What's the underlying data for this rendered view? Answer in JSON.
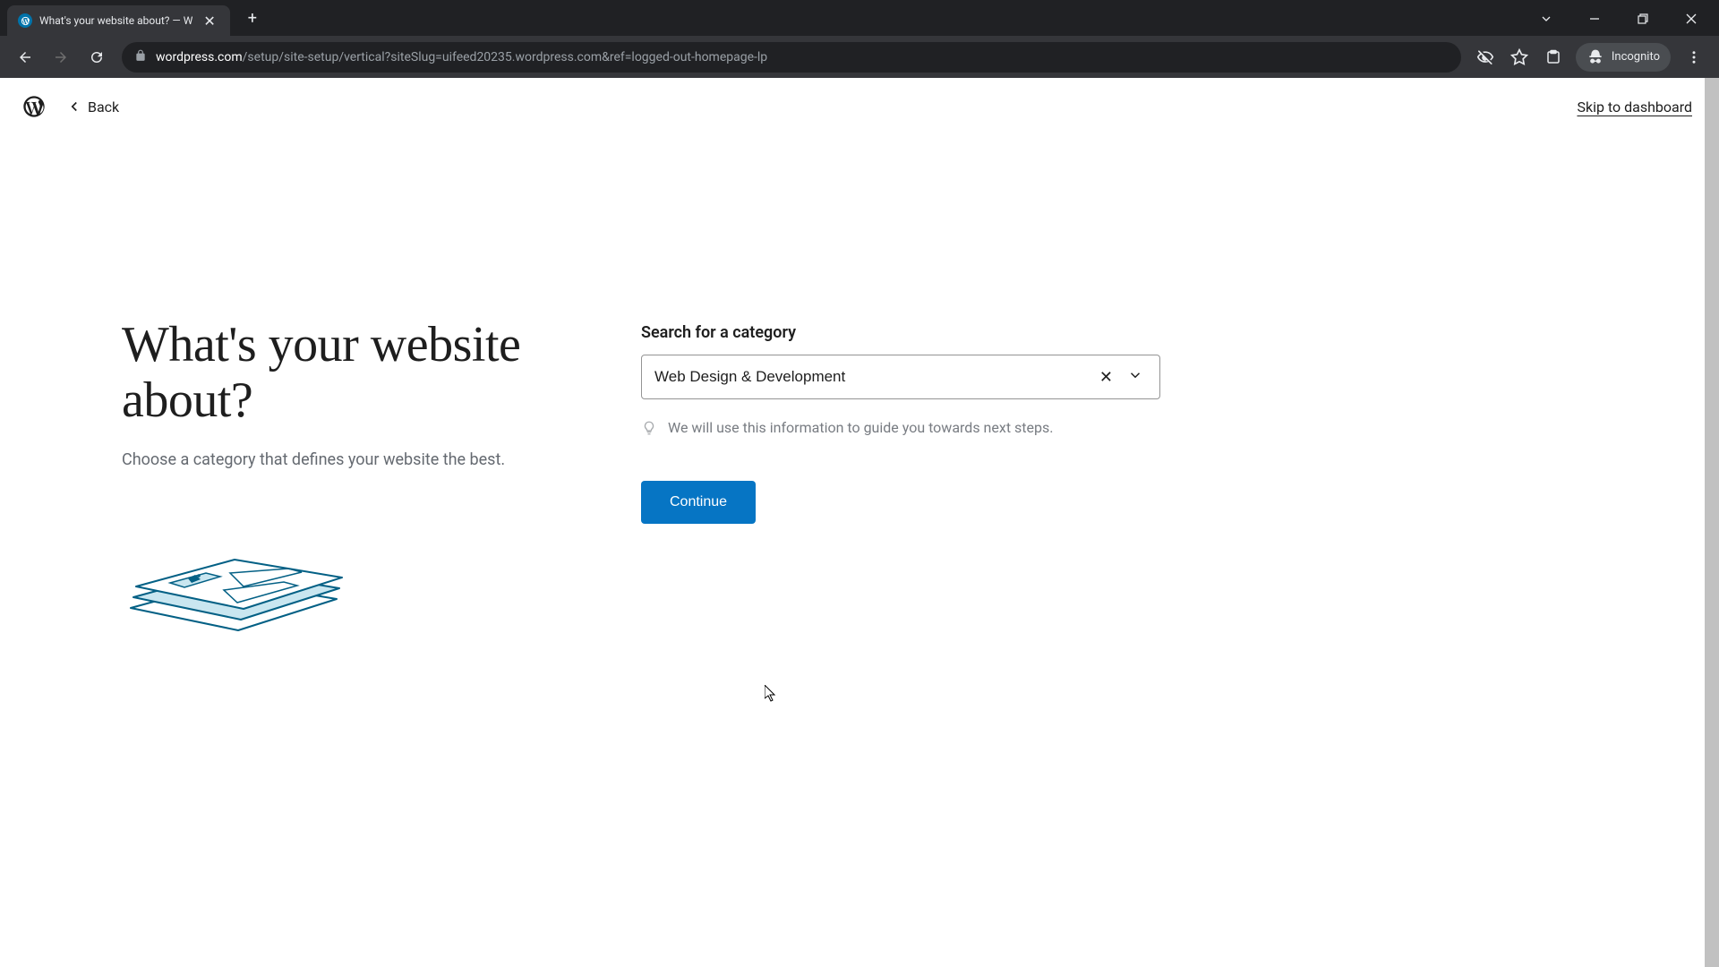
{
  "browser": {
    "tab_title": "What's your website about? — W",
    "url_domain": "wordpress.com",
    "url_path": "/setup/site-setup/vertical?siteSlug=uifeed20235.wordpress.com&ref=logged-out-homepage-lp",
    "incognito_label": "Incognito"
  },
  "header": {
    "back_label": "Back",
    "skip_label": "Skip to dashboard"
  },
  "main": {
    "heading": "What's your website about?",
    "subtitle": "Choose a category that defines your website the best.",
    "field_label": "Search for a category",
    "field_value": "Web Design & Development",
    "hint_text": "We will use this information to guide you towards next steps.",
    "continue_label": "Continue"
  }
}
